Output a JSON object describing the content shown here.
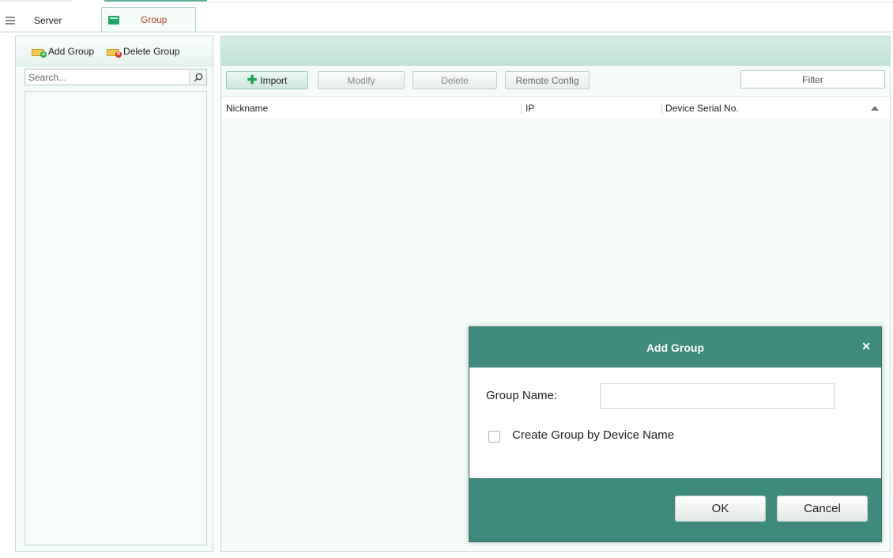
{
  "tabs": {
    "server_label": "Server",
    "group_label": "Group"
  },
  "left_panel": {
    "add_group_label": "Add Group",
    "delete_group_label": "Delete Group",
    "search_placeholder": "Search..."
  },
  "toolbar": {
    "import_label": "Import",
    "modify_label": "Modify",
    "delete_label": "Delete",
    "remote_config_label": "Remote Config",
    "filter_placeholder": "Filter"
  },
  "table": {
    "columns": [
      "Nickname",
      "IP",
      "Device Serial No."
    ],
    "rows": []
  },
  "dialog": {
    "title": "Add Group",
    "group_name_label": "Group Name:",
    "group_name_value": "",
    "create_by_device_label": "Create Group by Device Name",
    "create_by_device_checked": false,
    "ok_label": "OK",
    "cancel_label": "Cancel"
  },
  "colors": {
    "accent": "#3e8a7d",
    "active_tab_text": "#c0392b",
    "panel_bg": "#f4fbf8"
  }
}
